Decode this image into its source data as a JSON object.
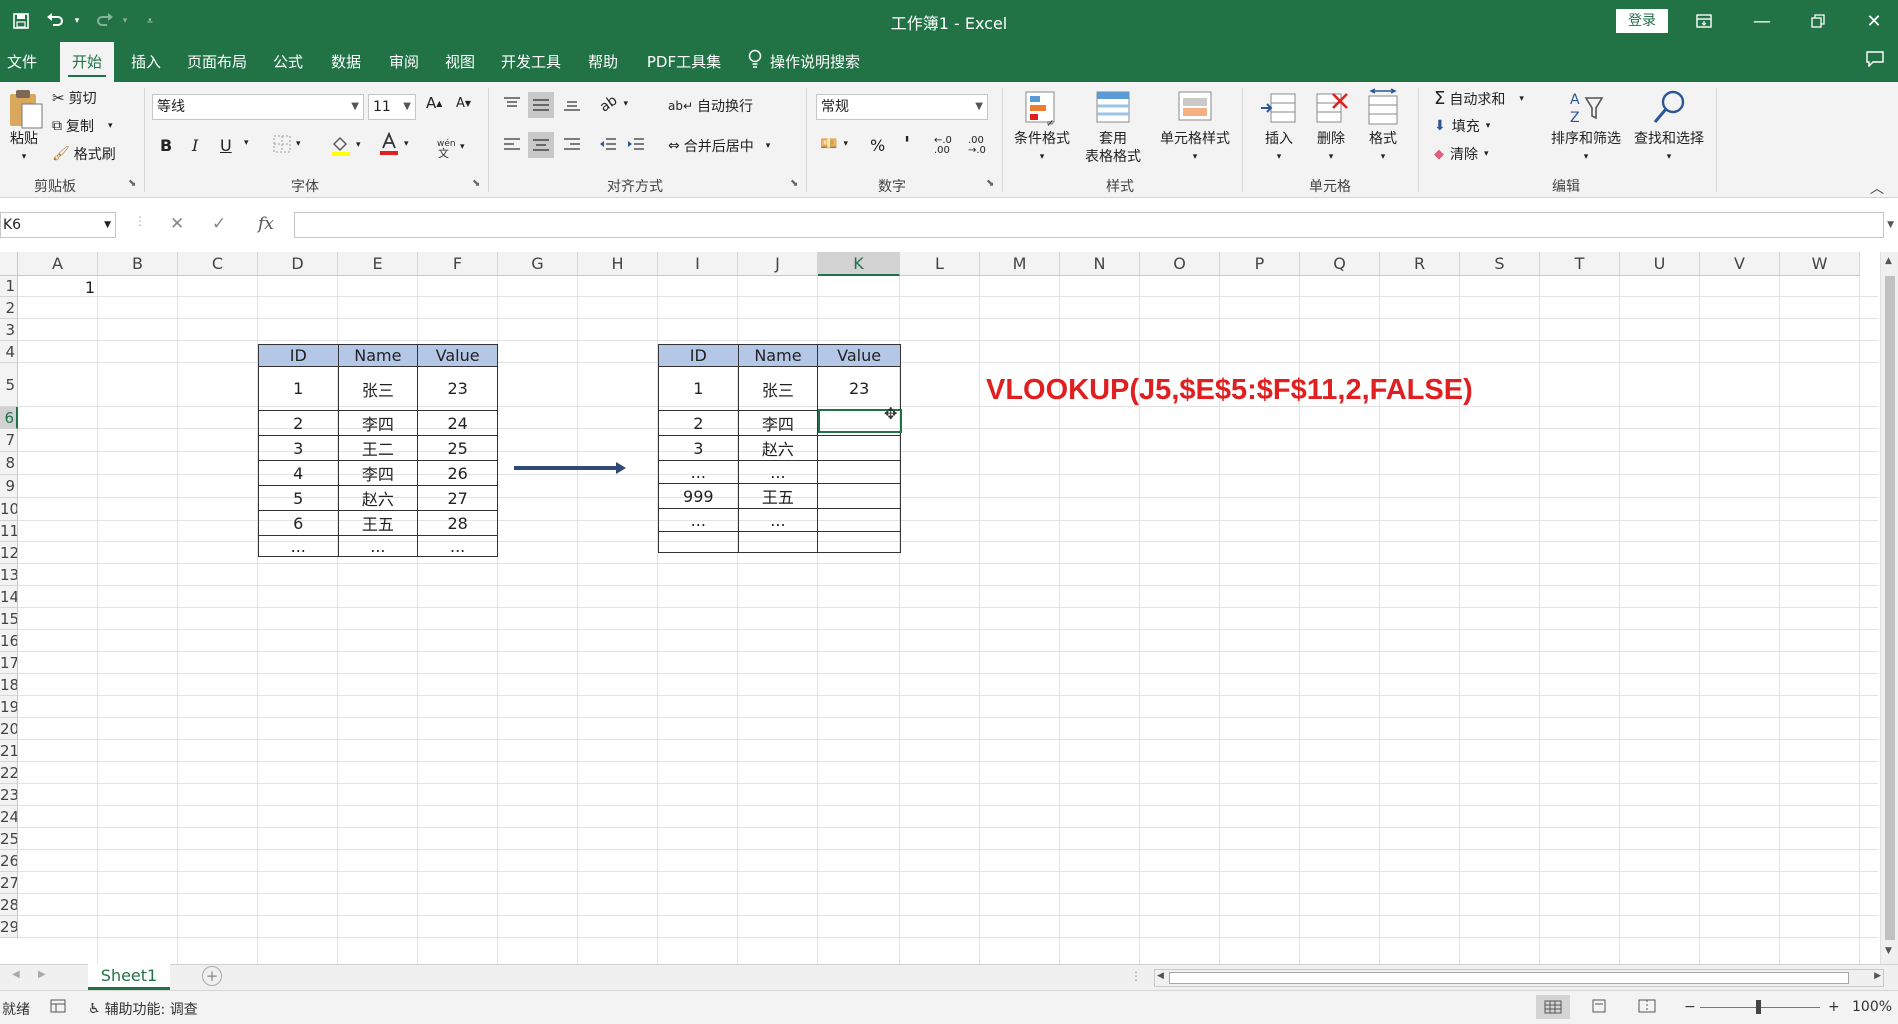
{
  "window": {
    "title": "工作簿1  -  Excel",
    "login_label": "登录",
    "colors": {
      "accent": "#217346",
      "header_fill": "#b4c7e7",
      "formula_red": "#e02020"
    }
  },
  "menu": {
    "tabs": [
      "文件",
      "开始",
      "插入",
      "页面布局",
      "公式",
      "数据",
      "审阅",
      "视图",
      "开发工具",
      "帮助",
      "PDF工具集",
      "操作说明搜索"
    ],
    "active": "开始"
  },
  "ribbon": {
    "clipboard": {
      "paste": "粘贴",
      "cut": "剪切",
      "copy": "复制",
      "format_painter": "格式刷",
      "label": "剪贴板"
    },
    "font": {
      "name": "等线",
      "size": "11",
      "bold": "B",
      "italic": "I",
      "underline": "U",
      "grow": "A",
      "shrink": "A",
      "label": "字体"
    },
    "alignment": {
      "wrap": "自动换行",
      "merge": "合并后居中",
      "label": "对齐方式"
    },
    "number": {
      "format": "常规",
      "percent": "%",
      "comma": "'",
      "label": "数字"
    },
    "styles": {
      "conditional": "条件格式",
      "table_line1": "套用",
      "table_line2": "表格格式",
      "cell_styles": "单元格样式",
      "label": "样式"
    },
    "cells": {
      "insert": "插入",
      "delete": "删除",
      "format": "格式",
      "label": "单元格"
    },
    "editing": {
      "autosum": "自动求和",
      "fill": "填充",
      "clear": "清除",
      "sort": "排序和筛选",
      "find": "查找和选择",
      "label": "编辑"
    }
  },
  "formula_bar": {
    "name_box": "K6",
    "fx": "fx",
    "content": ""
  },
  "grid": {
    "columns": [
      "A",
      "B",
      "C",
      "D",
      "E",
      "F",
      "G",
      "H",
      "I",
      "J",
      "K",
      "L",
      "M",
      "N",
      "O",
      "P",
      "Q",
      "R",
      "S",
      "T",
      "U",
      "V",
      "W"
    ],
    "rows": [
      "1",
      "2",
      "3",
      "4",
      "5",
      "6",
      "7",
      "8",
      "9",
      "10",
      "11",
      "12",
      "13",
      "14",
      "15",
      "16",
      "17",
      "18",
      "19",
      "20",
      "21",
      "22",
      "23",
      "24",
      "25",
      "26",
      "27",
      "28",
      "29"
    ],
    "selected_column": "K",
    "selected_row": "6",
    "a1_value": "1"
  },
  "source_table": {
    "headers": [
      "ID",
      "Name",
      "Value"
    ],
    "rows": [
      [
        "1",
        "张三",
        "23"
      ],
      [
        "2",
        "李四",
        "24"
      ],
      [
        "3",
        "王二",
        "25"
      ],
      [
        "4",
        "李四",
        "26"
      ],
      [
        "5",
        "赵六",
        "27"
      ],
      [
        "6",
        "王五",
        "28"
      ],
      [
        "...",
        "...",
        "..."
      ]
    ]
  },
  "lookup_table": {
    "headers": [
      "ID",
      "Name",
      "Value"
    ],
    "rows": [
      [
        "1",
        "张三",
        "23"
      ],
      [
        "2",
        "李四",
        ""
      ],
      [
        "3",
        "赵六",
        ""
      ],
      [
        "...",
        "...",
        ""
      ],
      [
        "999",
        "王五",
        ""
      ],
      [
        "...",
        "...",
        ""
      ],
      [
        "",
        "",
        ""
      ]
    ]
  },
  "formula_note": "VLOOKUP(J5,$E$5:$F$11,2,FALSE)",
  "sheets": {
    "tabs": [
      "Sheet1"
    ],
    "active": "Sheet1"
  },
  "status": {
    "ready": "就绪",
    "accessibility": "辅助功能: 调查",
    "zoom": "100%"
  }
}
